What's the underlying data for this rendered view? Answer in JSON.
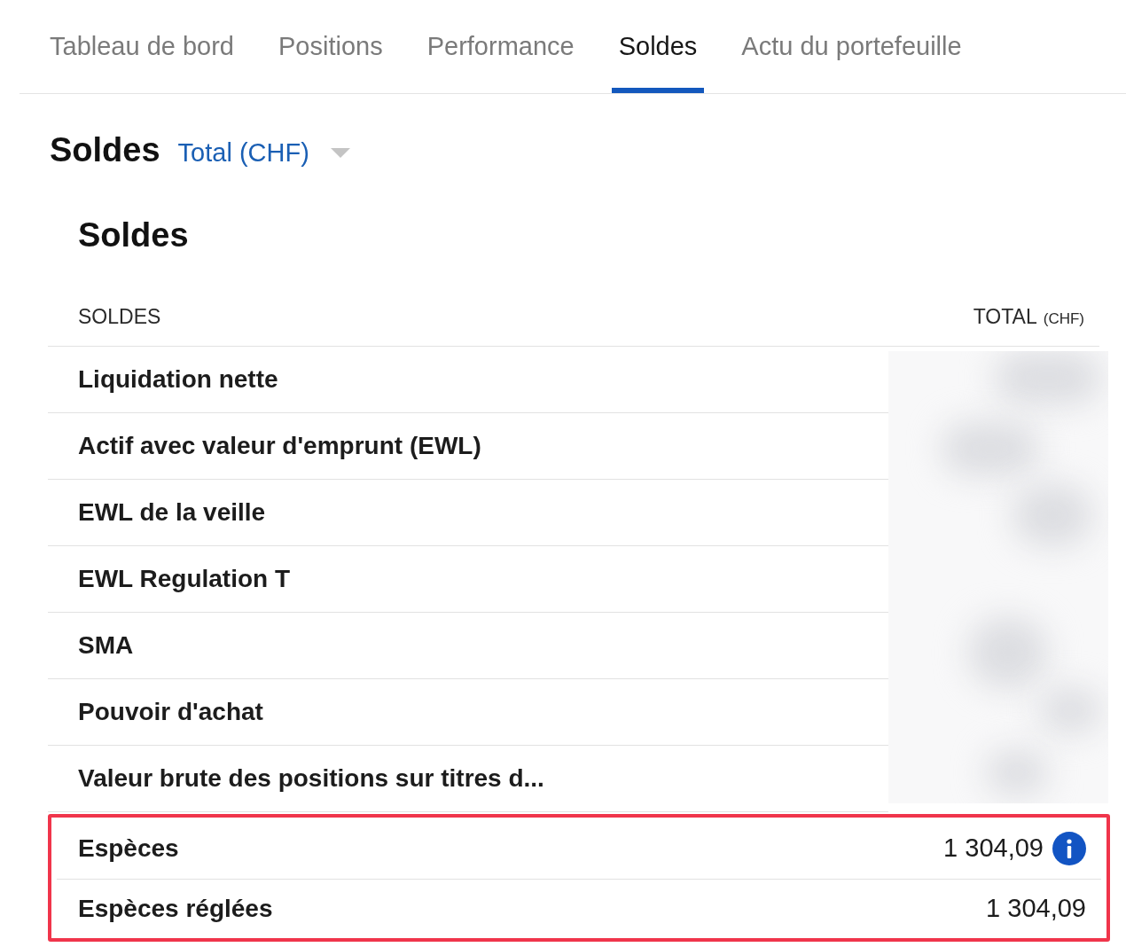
{
  "tabs": [
    {
      "label": "Tableau de bord",
      "selected": false
    },
    {
      "label": "Positions",
      "selected": false
    },
    {
      "label": "Performance",
      "selected": false
    },
    {
      "label": "Soldes",
      "selected": true
    },
    {
      "label": "Actu du portefeuille",
      "selected": false
    }
  ],
  "header": {
    "title": "Soldes",
    "selector": "Total (CHF)"
  },
  "section": {
    "title": "Soldes"
  },
  "table": {
    "columns": [
      {
        "label": "SOLDES"
      },
      {
        "label": "TOTAL",
        "unit": "(CHF)"
      }
    ],
    "rows": [
      {
        "label": "Liquidation nette",
        "kind": "redacted",
        "highlighted": false
      },
      {
        "label": "Actif avec valeur d'emprunt (EWL)",
        "kind": "redacted",
        "highlighted": false
      },
      {
        "label": "EWL de la veille",
        "kind": "redacted",
        "highlighted": false
      },
      {
        "label": "EWL Regulation T",
        "kind": "redacted",
        "highlighted": false
      },
      {
        "label": "SMA",
        "kind": "redacted",
        "highlighted": false
      },
      {
        "label": "Pouvoir d'achat",
        "kind": "redacted",
        "highlighted": false
      },
      {
        "label": "Valeur brute des positions sur titres d...",
        "kind": "redacted",
        "highlighted": false
      },
      {
        "label": "Espèces",
        "kind": "amount",
        "value": "1 304,09",
        "info": true,
        "highlighted": true
      },
      {
        "label": "Espèces réglées",
        "kind": "amount",
        "value": "1 304,09",
        "info": false,
        "highlighted": true
      }
    ]
  }
}
